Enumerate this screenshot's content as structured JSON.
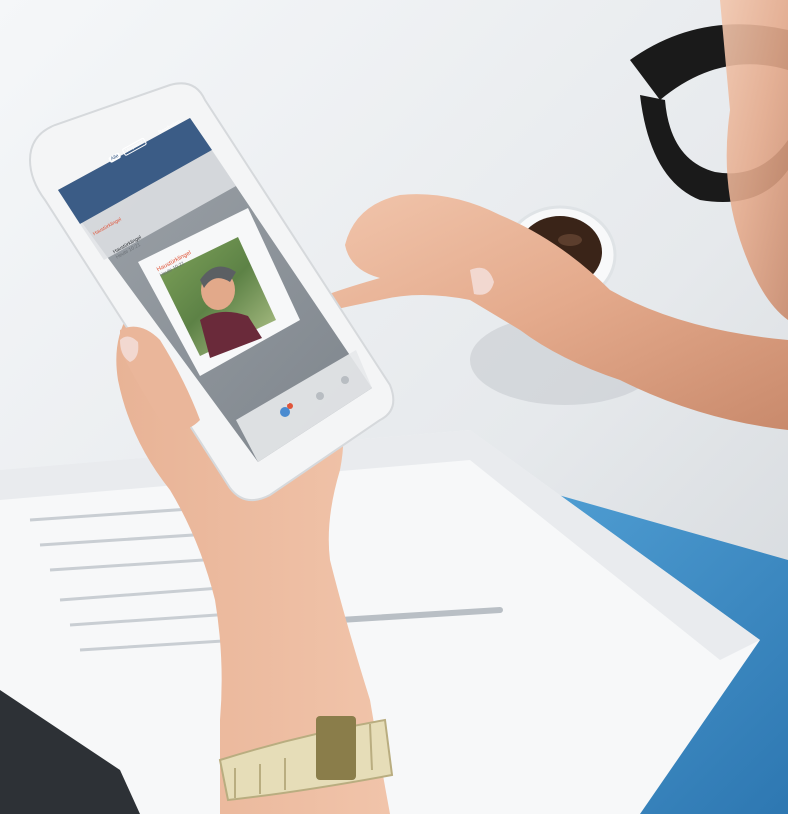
{
  "photo": {
    "description_tags": [
      "hands",
      "smartphone",
      "coffee-cup",
      "paper-documents",
      "blue-folder",
      "glasses",
      "wristwatch"
    ]
  },
  "phone_screen": {
    "header": {
      "tab_active": "Alle",
      "tab_inactive": "Verpasst",
      "right_label": "Bearbeiten"
    },
    "list": {
      "item1_title": "Haustürklingel",
      "item1_subtitle": "Gestern 16:31",
      "item2_title": "Haustürklingel",
      "item2_subtitle": "Heute 10:21"
    },
    "popup": {
      "title": "Haustürklingel",
      "subtitle": "Heute 10:21"
    },
    "badge_count": "1",
    "accent_color": "#e0553a",
    "header_color": "#3b5c86"
  }
}
